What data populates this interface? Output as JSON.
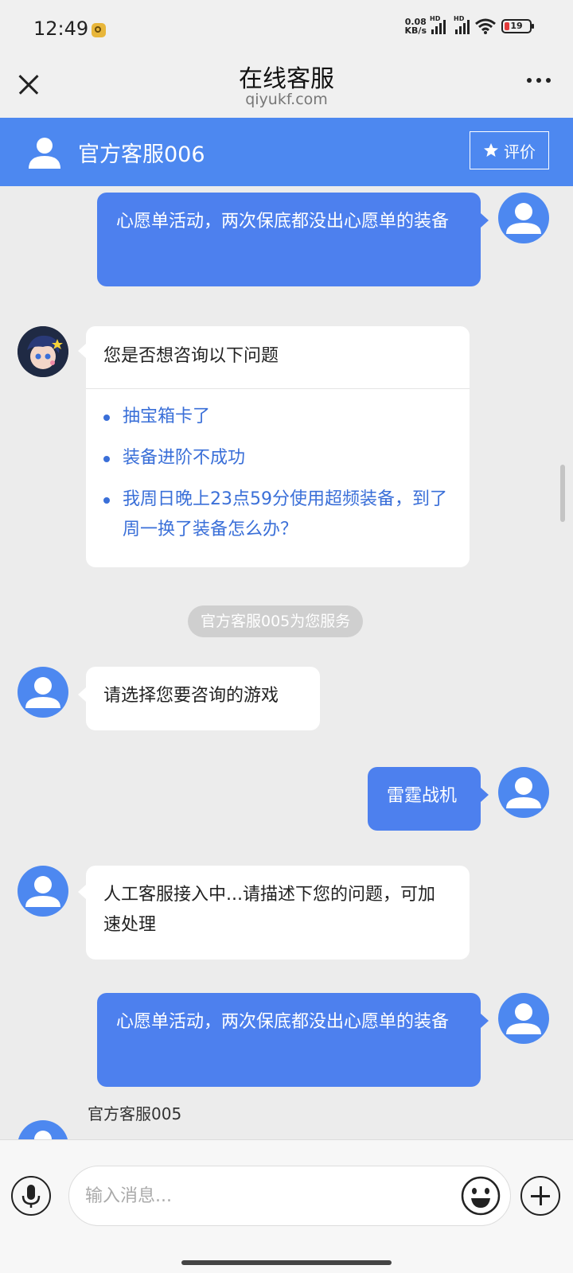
{
  "status_bar": {
    "time": "12:49",
    "net_speed_value": "0.08",
    "net_speed_unit": "KB/s",
    "hd1": "HD",
    "hd2": "HD",
    "battery": "19"
  },
  "titlebar": {
    "title": "在线客服",
    "url": "qiyukf.com"
  },
  "header": {
    "agent_name": "官方客服006",
    "rate_label": "评价"
  },
  "messages": {
    "m1": "心愿单活动，两次保底都没出心愿单的装备",
    "faq": {
      "title": "您是否想咨询以下问题",
      "items": [
        "抽宝箱卡了",
        "装备进阶不成功",
        "我周日晚上23点59分使用超频装备，到了周一换了装备怎么办？"
      ]
    },
    "system_notice": "官方客服005为您服务",
    "m3": "请选择您要咨询的游戏",
    "m4": "雷霆战机",
    "m5": "人工客服接入中...请描述下您的问题，可加速处理",
    "m6": "心愿单活动，两次保底都没出心愿单的装备",
    "last_sender": "官方客服005"
  },
  "input": {
    "placeholder": "输入消息..."
  },
  "colors": {
    "accent": "#4d88f0",
    "link": "#3a6fd8"
  }
}
